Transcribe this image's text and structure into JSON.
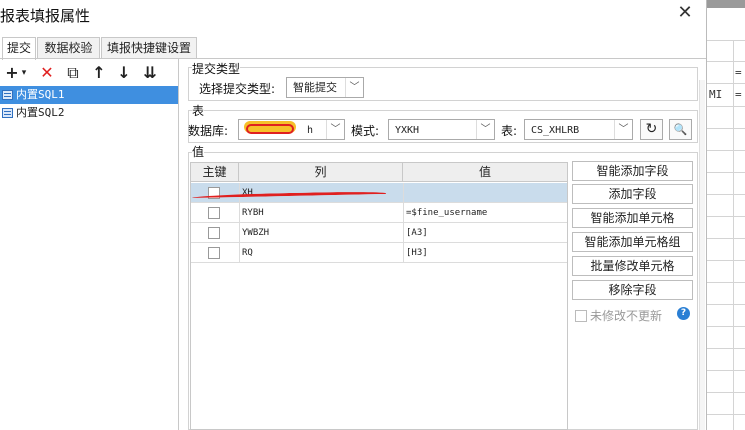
{
  "window": {
    "title": "报表填报属性"
  },
  "tabs": [
    {
      "label": "提交"
    },
    {
      "label": "数据校验"
    },
    {
      "label": "填报快捷键设置"
    }
  ],
  "toolbar": {
    "add": "+",
    "add_arrow": "▾",
    "delete": "✕",
    "copy": "⧉",
    "up": "↑",
    "down": "↓",
    "more": "⇊"
  },
  "tree": {
    "items": [
      {
        "label": "内置SQL1"
      },
      {
        "label": "内置SQL2"
      }
    ]
  },
  "submit_type": {
    "legend": "提交类型",
    "label": "选择提交类型:",
    "value": "智能提交"
  },
  "table": {
    "legend": "表",
    "db_label": "数据库:",
    "db_value_visible": "h",
    "schema_label": "模式:",
    "schema_value": "YXKH",
    "table_label": "表:",
    "table_value": "CS_XHLRB"
  },
  "values": {
    "legend": "值",
    "columns": [
      "主键",
      "列",
      "值"
    ],
    "rows": [
      {
        "col": "XH",
        "val": ""
      },
      {
        "col": "RYBH",
        "val": "=$fine_username"
      },
      {
        "col": "YWBZH",
        "val": "[A3]"
      },
      {
        "col": "RQ",
        "val": "[H3]"
      }
    ]
  },
  "side_buttons": {
    "smart_add_field": "智能添加字段",
    "add_field": "添加字段",
    "smart_add_cell": "智能添加单元格",
    "smart_add_cell_group": "智能添加单元格组",
    "batch_modify_cell": "批量修改单元格",
    "remove_field": "移除字段"
  },
  "no_update_unmodified": "未修改不更新",
  "help_glyph": "?",
  "background_sheet": {
    "cell1": "=",
    "cell2": "MI",
    "cell3": "="
  },
  "colors": {
    "selection": "#3f8fe0",
    "row_selected": "#c9dcec",
    "annotation": "#e02020",
    "help": "#2a7fd4"
  }
}
